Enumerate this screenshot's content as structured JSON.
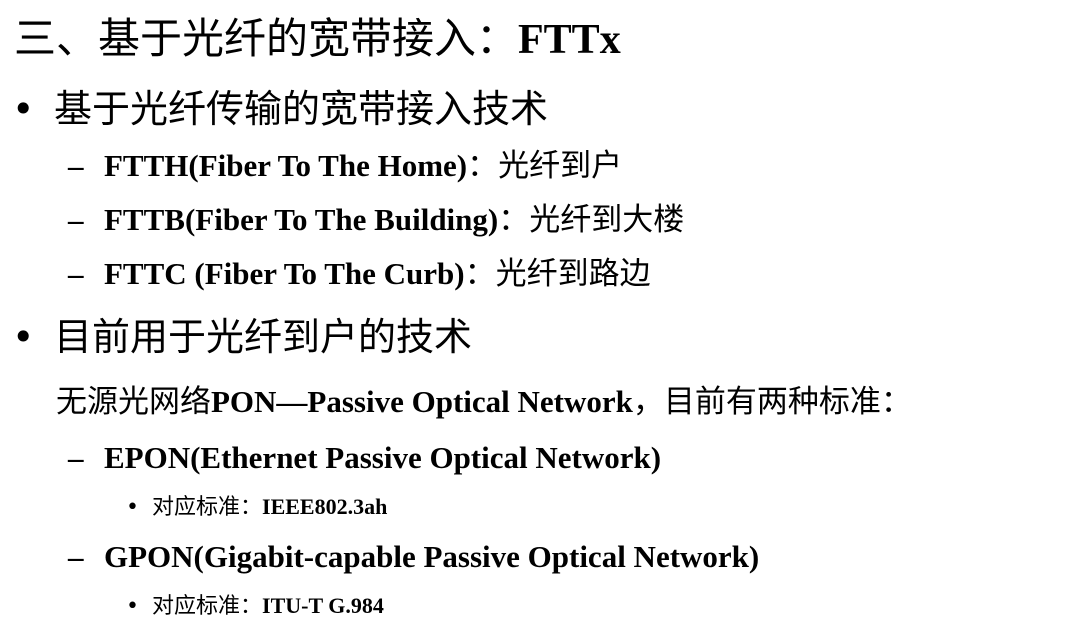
{
  "title": {
    "zh": "三、基于光纤的宽带接入：",
    "en": "FTTx"
  },
  "bullets": [
    {
      "mark": "•",
      "text": "基于光纤传输的宽带接入技术"
    },
    {
      "mark": "•",
      "text": "目前用于光纤到户的技术"
    }
  ],
  "fttx_items": [
    {
      "dash": "–",
      "en": "FTTH(Fiber To The Home)",
      "zh": "：光纤到户"
    },
    {
      "dash": "–",
      "en": "FTTB(Fiber To The Building)",
      "zh": "：光纤到大楼"
    },
    {
      "dash": "–",
      "en": "FTTC (Fiber To The Curb)",
      "zh": "：光纤到路边"
    }
  ],
  "pon_intro": {
    "zh1": "无源光网络",
    "en": "PON—Passive Optical Network",
    "zh2": "，目前有两种标准："
  },
  "pon_standards": [
    {
      "dash": "–",
      "name": "EPON(Ethernet Passive Optical Network)",
      "std_mark": "•",
      "std_label": "对应标准：",
      "std_value": "IEEE802.3ah"
    },
    {
      "dash": "–",
      "name": "GPON(Gigabit-capable Passive Optical Network)",
      "std_mark": "•",
      "std_label": "对应标准：",
      "std_value": "ITU-T G.984"
    }
  ]
}
